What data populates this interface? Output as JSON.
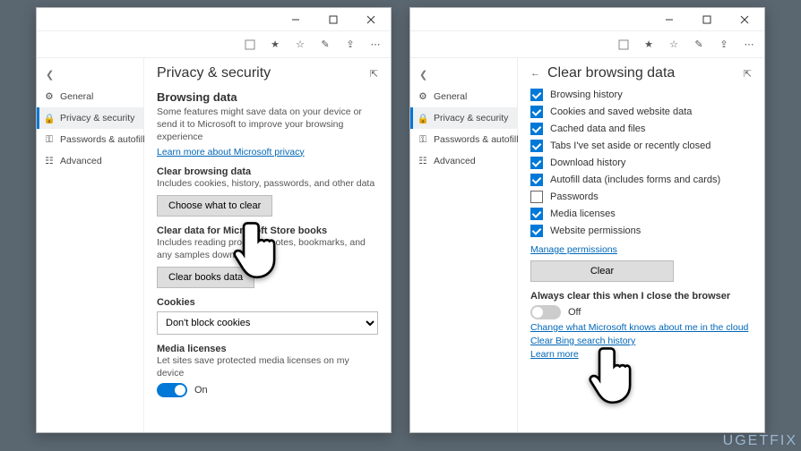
{
  "brand": "UGETFIX",
  "sidebar": {
    "items": [
      {
        "label": "General"
      },
      {
        "label": "Privacy & security"
      },
      {
        "label": "Passwords & autofill"
      },
      {
        "label": "Advanced"
      }
    ]
  },
  "left": {
    "title": "Privacy & security",
    "section_browsing": "Browsing data",
    "browsing_desc": "Some features might save data on your device or send it to Microsoft to improve your browsing experience",
    "learn_link": "Learn more about Microsoft privacy",
    "clear_head": "Clear browsing data",
    "clear_desc": "Includes cookies, history, passwords, and other data",
    "choose_btn": "Choose what to clear",
    "books_head": "Clear data for Microsoft Store books",
    "books_desc": "Includes reading progress, notes, bookmarks, and any samples downloaded",
    "books_btn": "Clear books data",
    "cookies_head": "Cookies",
    "cookies_value": "Don't block cookies",
    "media_head": "Media licenses",
    "media_desc": "Let sites save protected media licenses on my device",
    "media_toggle": "On"
  },
  "right": {
    "title": "Clear browsing data",
    "checks": [
      {
        "label": "Browsing history",
        "checked": true
      },
      {
        "label": "Cookies and saved website data",
        "checked": true
      },
      {
        "label": "Cached data and files",
        "checked": true
      },
      {
        "label": "Tabs I've set aside or recently closed",
        "checked": true
      },
      {
        "label": "Download history",
        "checked": true
      },
      {
        "label": "Autofill data (includes forms and cards)",
        "checked": true
      },
      {
        "label": "Passwords",
        "checked": false
      },
      {
        "label": "Media licenses",
        "checked": true
      },
      {
        "label": "Website permissions",
        "checked": true
      }
    ],
    "manage_link": "Manage permissions",
    "clear_btn": "Clear",
    "always_head": "Always clear this when I close the browser",
    "always_toggle": "Off",
    "change_link": "Change what Microsoft knows about me in the cloud",
    "bing_link": "Clear Bing search history",
    "learn_link": "Learn more"
  }
}
